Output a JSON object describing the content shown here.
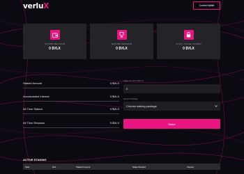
{
  "header": {
    "logo_main": "verlu",
    "logo_accent": "X",
    "connect_label": "Connect Wallet"
  },
  "cards": [
    {
      "label": "STAKED BALANCE",
      "value": "0 $VLX",
      "icon": "wallet-icon"
    },
    {
      "label": "EARNED REWARD",
      "value": "0 $VLX",
      "icon": "trophy-icon"
    },
    {
      "label": "TOTAL VALUE LOCKED",
      "value": "0 $VLX",
      "icon": "lock-icon"
    }
  ],
  "stats": [
    {
      "label": "Staked Amount",
      "value": "0 $VLX"
    },
    {
      "label": "Accumulated Interest",
      "value": "0 $VLX"
    },
    {
      "label": "All Time Staked",
      "value": "0 $VLX"
    },
    {
      "label": "All Time Rewards",
      "value": "0 $VLX"
    }
  ],
  "form": {
    "amount_label": "Stake Amount ($VLX)",
    "amount_value": "0",
    "package_label": "Select Package",
    "package_selected": "Choose staking package",
    "stake_button": "Stake"
  },
  "active": {
    "title": "ACTIVE STAKING",
    "columns": [
      "Start",
      "End",
      "Staked Amount",
      "Stake Reward",
      "Interest"
    ]
  },
  "colors": {
    "accent": "#e8147f",
    "background": "#0b0a10",
    "card": "#242327"
  }
}
